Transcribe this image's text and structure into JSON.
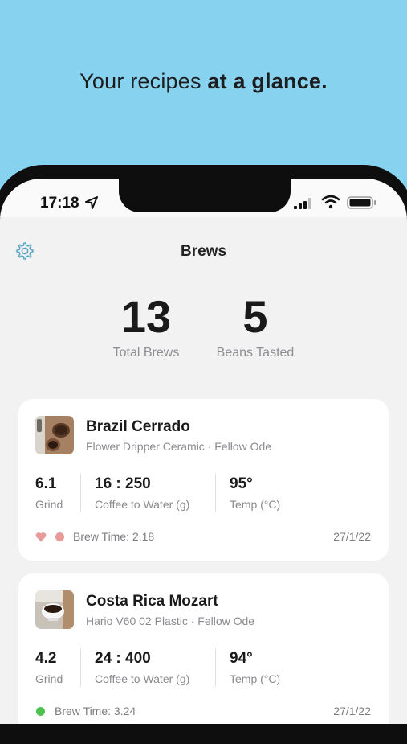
{
  "headline": {
    "prefix": "Your recipes ",
    "bold": "at a glance."
  },
  "status_bar": {
    "time": "17:18"
  },
  "header": {
    "title": "Brews"
  },
  "stats": [
    {
      "value": "13",
      "label": "Total Brews"
    },
    {
      "value": "5",
      "label": "Beans Tasted"
    }
  ],
  "brews": [
    {
      "name": "Brazil Cerrado",
      "subtitle": "Flower Dripper Ceramic · Fellow Ode",
      "grind": "6.1",
      "grind_label": "Grind",
      "ratio": "16 : 250",
      "ratio_label": "Coffee to Water (g)",
      "temp": "95°",
      "temp_label": "Temp (°C)",
      "favorite": true,
      "status_color": "#e89a9a",
      "brew_time": "Brew Time: 2.18",
      "date": "27/1/22"
    },
    {
      "name": "Costa Rica Mozart",
      "subtitle": "Hario V60 02 Plastic · Fellow Ode",
      "grind": "4.2",
      "grind_label": "Grind",
      "ratio": "24 : 400",
      "ratio_label": "Coffee to Water (g)",
      "temp": "94°",
      "temp_label": "Temp (°C)",
      "favorite": false,
      "status_color": "#4cc24f",
      "brew_time": "Brew Time: 3.24",
      "date": "27/1/22"
    }
  ],
  "colors": {
    "background": "#87d3ef",
    "screen": "#f2f2f3",
    "accent": "#5ba7c4",
    "heart": "#e89a9a",
    "green": "#4cc24f"
  },
  "icons": [
    "settings-gear-icon",
    "location-arrow-icon",
    "signal-icon",
    "wifi-icon",
    "battery-icon",
    "heart-icon"
  ]
}
